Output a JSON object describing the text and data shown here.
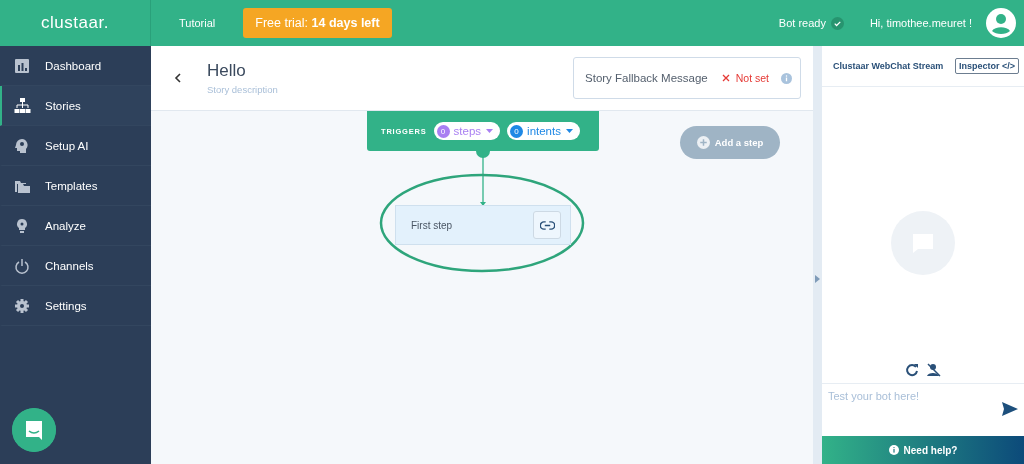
{
  "logo": "clustaar.",
  "topbar": {
    "tutorial": "Tutorial",
    "trial": "Free trial: **14 days left**",
    "bot_status": "Bot ready",
    "greeting": "Hi, timothee.meuret !"
  },
  "sidebar": {
    "items": [
      {
        "label": "Dashboard",
        "kind": "chart",
        "selected": false
      },
      {
        "label": "Stories",
        "kind": "tree",
        "selected": true
      },
      {
        "label": "Setup AI",
        "kind": "head",
        "selected": false
      },
      {
        "label": "Templates",
        "kind": "folder",
        "selected": false
      },
      {
        "label": "Analyze",
        "kind": "bulb",
        "selected": false
      },
      {
        "label": "Channels",
        "kind": "power",
        "selected": false
      },
      {
        "label": "Settings",
        "kind": "gear",
        "selected": false
      }
    ]
  },
  "story": {
    "title": "Hello",
    "description": "Story description",
    "fallback": {
      "label": "Story Fallback Message",
      "status": "Not set"
    }
  },
  "triggers": {
    "label": "TRIGGERS",
    "pills": [
      {
        "count": "0",
        "label": "steps",
        "color": "#a97ff2"
      },
      {
        "count": "0",
        "label": "intents",
        "color": "#1e88e5"
      }
    ]
  },
  "add_step": {
    "label": "Add a step",
    "disabled": true
  },
  "steps": [
    {
      "label": "First step"
    }
  ],
  "chat": {
    "title": "Clustaar WebChat Stream",
    "inspector": "Inspector",
    "inspector_icon": "</>",
    "placeholder": "Test your bot here!",
    "help": "Need help?"
  }
}
